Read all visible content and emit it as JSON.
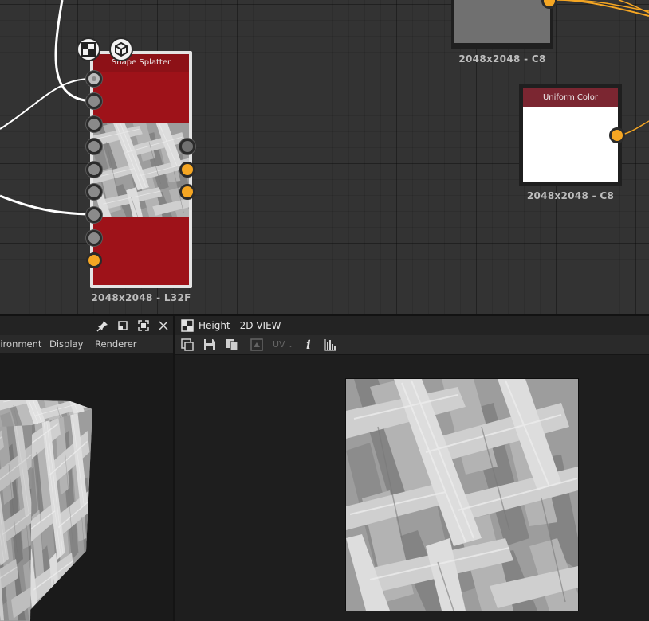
{
  "graph": {
    "splatter_node": {
      "title": "Shape Splatter",
      "resolution": "2048x2048 - L32F",
      "badge_icons": [
        "checker-icon",
        "cube-icon"
      ],
      "body_color": "#9e1219"
    },
    "gray_node": {
      "resolution": "2048x2048 - C8",
      "color": "#707070"
    },
    "uniform_node": {
      "title": "Uniform Color",
      "resolution": "2048x2048 - C8",
      "color": "#ffffff"
    },
    "colors": {
      "port_orange": "#f5a623",
      "wire_white": "#ffffff",
      "wire_orange": "#f5a623"
    }
  },
  "view3d": {
    "menu": [
      "Environment",
      "Display",
      "Renderer"
    ],
    "tab_icons": [
      "pin-icon",
      "float-icon",
      "maximize-icon",
      "close-icon"
    ]
  },
  "view2d": {
    "title": "Height - 2D VIEW",
    "toolbar_icons": [
      "fit-view-icon",
      "save-icon",
      "copy-icon",
      "tile-icon",
      "uv-dropdown",
      "info-icon",
      "histogram-icon"
    ],
    "uv_label": "UV",
    "info_label": "i"
  }
}
